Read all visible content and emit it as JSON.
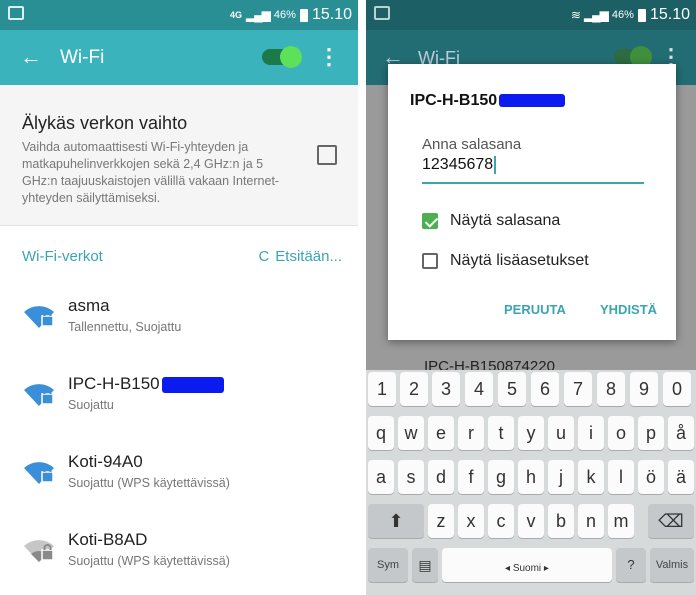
{
  "left": {
    "status": {
      "network": "4G",
      "battery": "46%",
      "time": "15.10"
    },
    "appbar": {
      "back": "←",
      "title": "Wi-Fi",
      "more": "⋮"
    },
    "smart": {
      "title": "Älykäs verkon vaihto",
      "description": "Vaihda automaattisesti Wi-Fi-yhteyden ja matkapuhelinverkkojen sekä 2,4 GHz:n ja 5 GHz:n taajuuskaistojen välillä vakaan Internet-yhteyden säilyttämiseksi.",
      "checked": false
    },
    "section": {
      "title": "Wi-Fi-verkot",
      "scan_icon": "C",
      "scanning": "Etsitään..."
    },
    "networks": [
      {
        "name": "asma",
        "status": "Tallennettu, Suojattu"
      },
      {
        "name": "IPC-H-B150",
        "status": "Suojattu"
      },
      {
        "name": "Koti-94A0",
        "status": "Suojattu (WPS käytettävissä)"
      },
      {
        "name": "Koti-B8AD",
        "status": "Suojattu (WPS käytettävissä)"
      }
    ]
  },
  "right": {
    "status": {
      "battery": "46%",
      "time": "15.10"
    },
    "bg": {
      "title": "Wi-Fi",
      "peek": "IPC-H-B150874220"
    },
    "dialog": {
      "title": "IPC-H-B150",
      "password_label": "Anna salasana",
      "password_value": "12345678",
      "show_password": "Näytä salasana",
      "show_password_checked": true,
      "advanced": "Näytä lisäasetukset",
      "advanced_checked": false,
      "cancel": "PERUUTA",
      "connect": "YHDISTÄ"
    },
    "keyboard": {
      "row_numbers": [
        "1",
        "2",
        "3",
        "4",
        "5",
        "6",
        "7",
        "8",
        "9",
        "0"
      ],
      "row1": [
        "q",
        "w",
        "e",
        "r",
        "t",
        "y",
        "u",
        "i",
        "o",
        "p",
        "å"
      ],
      "row2": [
        "a",
        "s",
        "d",
        "f",
        "g",
        "h",
        "j",
        "k",
        "l",
        "ö",
        "ä"
      ],
      "row3": [
        "z",
        "x",
        "c",
        "v",
        "b",
        "n",
        "m"
      ],
      "sym": "Sym",
      "space": "◂ Suomi ▸",
      "punct": "?",
      "enter": "Valmis",
      "shift": "⬆",
      "backspace": "⌫"
    }
  }
}
